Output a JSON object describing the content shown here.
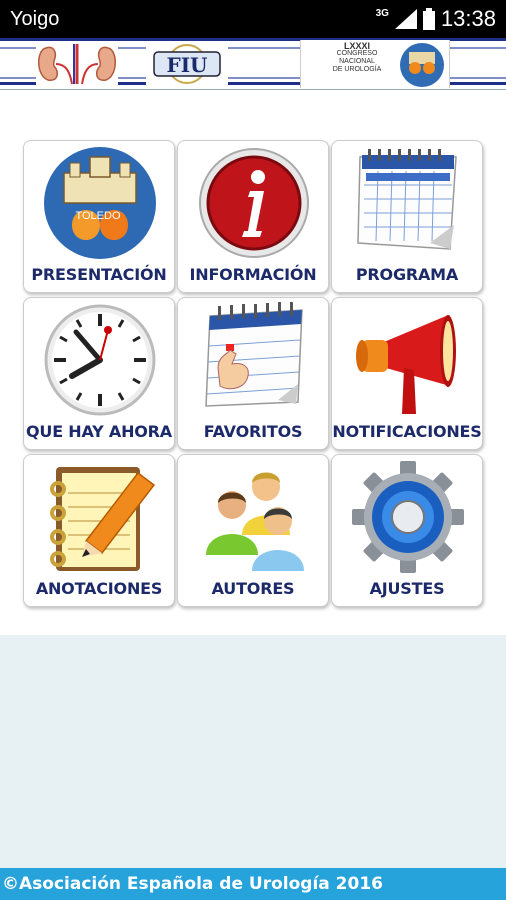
{
  "status_bar": {
    "carrier": "Yoigo",
    "network": "3G",
    "time": "13:38"
  },
  "header": {
    "fiu_logo_text": "FIU",
    "congress_numeral": "LXXXI",
    "congress_line1": "CONGRESO",
    "congress_line2": "NACIONAL",
    "congress_line3": "DE UROLOGÍA",
    "toledo_text": "TOLEDO"
  },
  "menu": [
    {
      "label": "PRESENTACIÓN",
      "icon": "toledo-logo-icon"
    },
    {
      "label": "INFORMACIÓN",
      "icon": "info-icon"
    },
    {
      "label": "PROGRAMA",
      "icon": "calendar-icon"
    },
    {
      "label": "QUE HAY AHORA",
      "icon": "clock-icon"
    },
    {
      "label": "FAVORITOS",
      "icon": "calendar-tap-icon"
    },
    {
      "label": "NOTIFICACIONES",
      "icon": "megaphone-icon"
    },
    {
      "label": "ANOTACIONES",
      "icon": "notepad-pencil-icon"
    },
    {
      "label": "AUTORES",
      "icon": "people-icon"
    },
    {
      "label": "AJUSTES",
      "icon": "gear-icon"
    }
  ],
  "footer": {
    "text": "©Asociación Española de Urología 2016"
  },
  "colors": {
    "label_text": "#1d2a6a",
    "footer_bg": "#27a3dc",
    "lower_bg": "#e7f0f3"
  }
}
